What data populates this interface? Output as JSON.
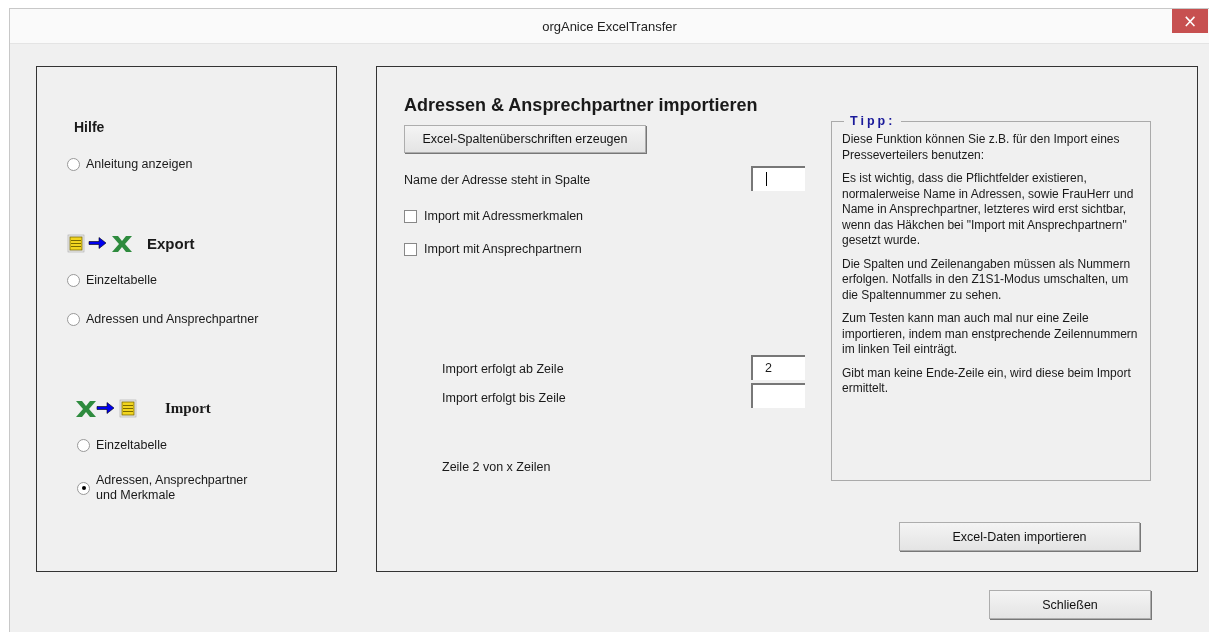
{
  "window": {
    "title": "orgAnice ExcelTransfer",
    "close": "×"
  },
  "sections": [
    {
      "kind": "help",
      "heading": "Hilfe",
      "options": [
        {
          "label": "Anleitung anzeigen",
          "selected": false
        }
      ]
    },
    {
      "kind": "export",
      "heading": "Export",
      "options": [
        {
          "label": "Einzeltabelle",
          "selected": false
        },
        {
          "label": "Adressen und Ansprechpartner",
          "selected": false
        }
      ]
    },
    {
      "kind": "import",
      "heading": "Import",
      "options": [
        {
          "label": "Einzeltabelle",
          "selected": false
        },
        {
          "label": "Adressen, Ansprechpartner\nund Merkmale",
          "selected": true
        }
      ]
    }
  ],
  "main": {
    "heading": "Adressen & Ansprechpartner importieren",
    "generate_button": "Excel-Spaltenüberschriften erzeugen",
    "column_field": {
      "label": "Name der Adresse steht in Spalte",
      "focused": true
    },
    "checkboxes": [
      {
        "label": "Import mit Adressmerkmalen",
        "checked": false
      },
      {
        "label": "Import mit Ansprechpartnern",
        "checked": false
      }
    ],
    "row_fields": [
      {
        "label": "Import erfolgt ab Zeile",
        "value": "2"
      },
      {
        "label": "Import erfolgt bis Zeile"
      }
    ],
    "status": "Zeile 2 von x Zeilen",
    "tip": {
      "title": "Tipp:",
      "paragraphs": [
        "Diese Funktion können Sie z.B. für den Import eines Presseverteilers benutzen:",
        "Es ist wichtig, dass die Pflichtfelder existieren, normalerweise Name in Adressen, sowie FrauHerr und Name in Ansprechpartner, letzteres wird erst sichtbar, wenn das Häkchen bei \"Import mit Ansprechpartnern\" gesetzt wurde.",
        "Die Spalten und Zeilenangaben müssen als Nummern erfolgen. Notfalls in den Z1S1-Modus umschalten, um die Spaltennummer zu sehen.",
        "Zum Testen kann man auch mal nur eine Zeile importieren, indem man enstprechende Zeilennummern im linken Teil einträgt.",
        "Gibt man keine Ende-Zeile ein, wird diese beim Import ermittelt."
      ]
    },
    "import_button": "Excel-Daten importieren"
  },
  "close_button": "Schließen"
}
